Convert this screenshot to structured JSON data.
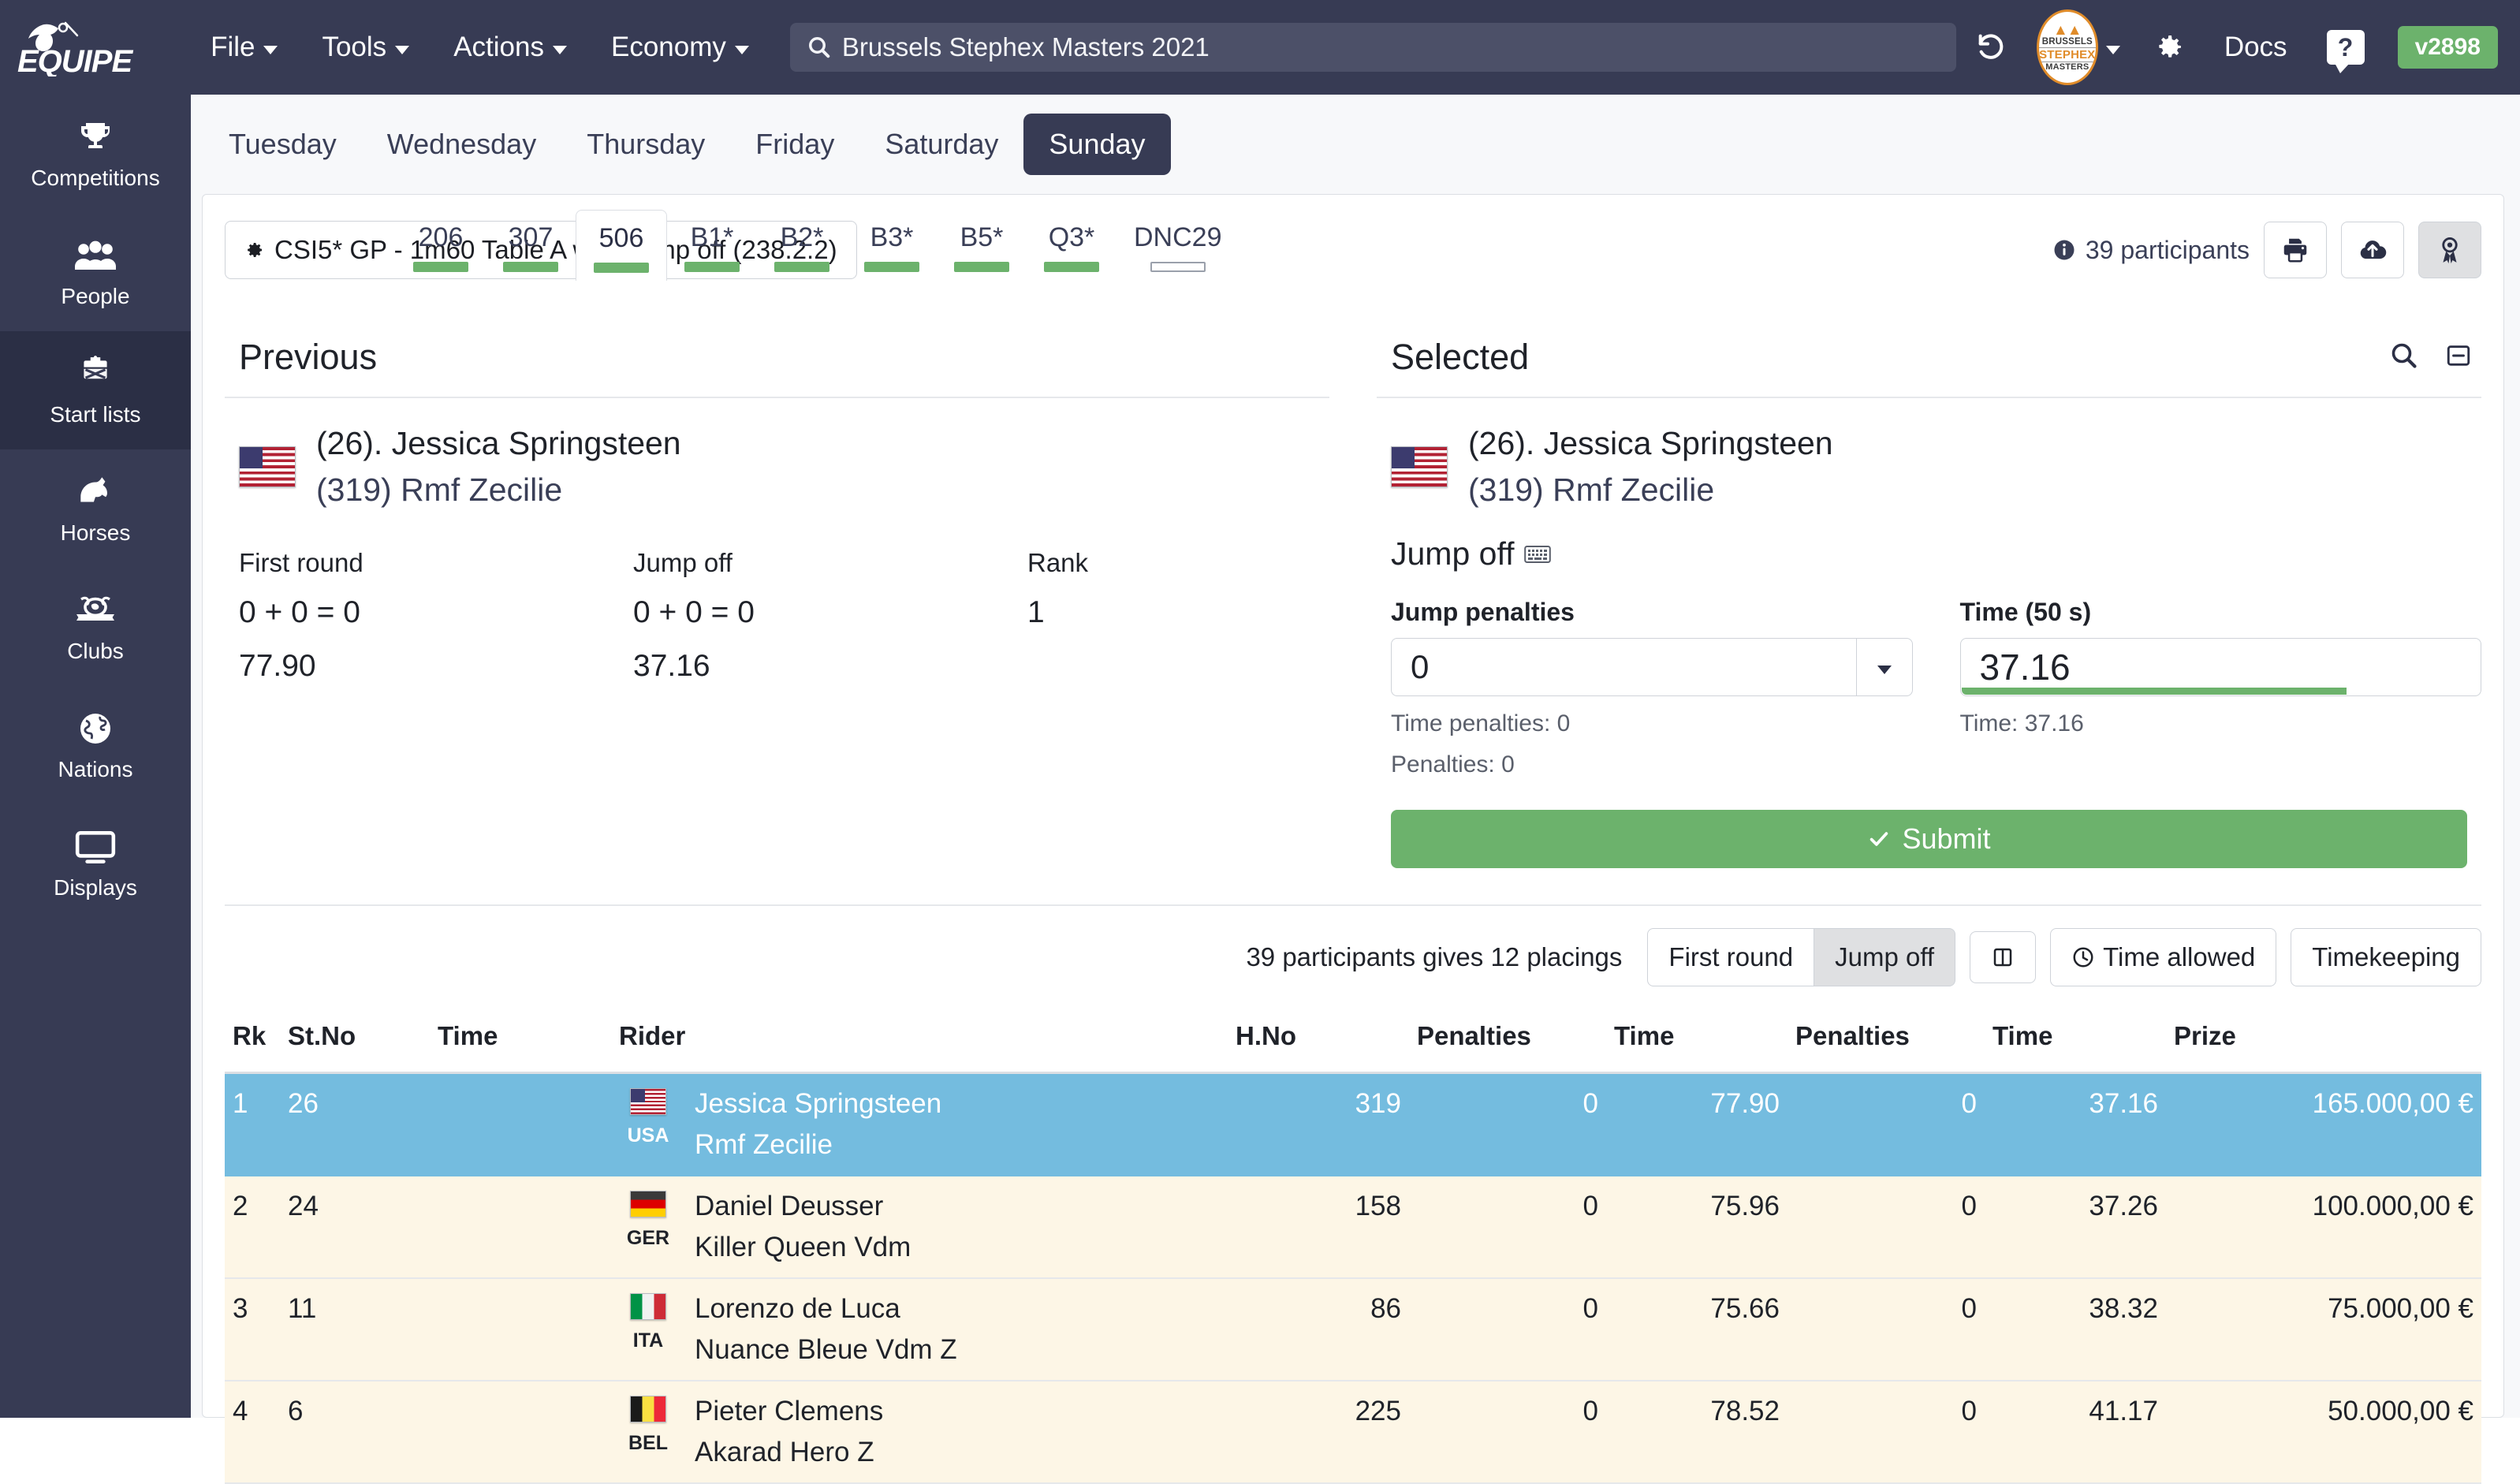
{
  "navbar": {
    "logo_text": "EQUIPE",
    "menu": [
      {
        "label": "File"
      },
      {
        "label": "Tools"
      },
      {
        "label": "Actions"
      },
      {
        "label": "Economy"
      }
    ],
    "search": {
      "value": "Brussels Stephex Masters 2021",
      "icon": "search-icon"
    },
    "history_icon": "history-undo-icon",
    "event_badge": {
      "line1": "BRUSSELS",
      "line2": "STEPHEX",
      "line3": "MASTERS"
    },
    "settings_icon": "gear-icon",
    "docs_label": "Docs",
    "help_label": "?",
    "version": "v2898"
  },
  "sidebar": {
    "items": [
      {
        "label": "Competitions",
        "icon": "trophy-icon",
        "active": false
      },
      {
        "label": "People",
        "icon": "people-icon",
        "active": false
      },
      {
        "label": "Start lists",
        "icon": "clipboard-icon",
        "active": true
      },
      {
        "label": "Horses",
        "icon": "horse-head-icon",
        "active": false
      },
      {
        "label": "Clubs",
        "icon": "club-crest-icon",
        "active": false
      },
      {
        "label": "Nations",
        "icon": "globe-icon",
        "active": false
      },
      {
        "label": "Displays",
        "icon": "monitor-icon",
        "active": false
      }
    ]
  },
  "days": [
    {
      "label": "Tuesday",
      "active": false
    },
    {
      "label": "Wednesday",
      "active": false
    },
    {
      "label": "Thursday",
      "active": false
    },
    {
      "label": "Friday",
      "active": false
    },
    {
      "label": "Saturday",
      "active": false
    },
    {
      "label": "Sunday",
      "active": true
    }
  ],
  "classes": [
    {
      "label": "206",
      "active": false,
      "status": "green"
    },
    {
      "label": "307",
      "active": false,
      "status": "green"
    },
    {
      "label": "506",
      "active": true,
      "status": "green"
    },
    {
      "label": "B1*",
      "active": false,
      "status": "green"
    },
    {
      "label": "B2*",
      "active": false,
      "status": "green"
    },
    {
      "label": "B3*",
      "active": false,
      "status": "green"
    },
    {
      "label": "B5*",
      "active": false,
      "status": "green"
    },
    {
      "label": "Q3*",
      "active": false,
      "status": "green"
    },
    {
      "label": "DNC29",
      "active": false,
      "status": "empty"
    }
  ],
  "class_header": {
    "gear_icon": "gear-icon",
    "title": "CSI5* GP - 1m60 Table A with Jump off (238.2.2)",
    "participants": "39 participants",
    "info_icon": "info-circle-icon",
    "buttons": [
      {
        "icon": "printer-icon",
        "name": "print-button",
        "pressed": false
      },
      {
        "icon": "cloud-upload-icon",
        "name": "upload-button",
        "pressed": false
      },
      {
        "icon": "rosette-award-icon",
        "name": "prizes-button",
        "pressed": true
      }
    ]
  },
  "previous": {
    "title": "Previous",
    "flag": "usa-flag",
    "rider": "(26). Jessica Springsteen",
    "horse": "(319) Rmf Zecilie",
    "stats": [
      {
        "label": "First round",
        "value1": "0 + 0 = 0",
        "value2": "77.90"
      },
      {
        "label": "Jump off",
        "value1": "0 + 0 = 0",
        "value2": "37.16"
      },
      {
        "label": "Rank",
        "value1": "1",
        "value2": ""
      }
    ]
  },
  "selected": {
    "title": "Selected",
    "search_icon": "search-icon",
    "collapse_icon": "collapse-minus-icon",
    "flag": "usa-flag",
    "rider": "(26). Jessica Springsteen",
    "horse": "(319) Rmf Zecilie",
    "round_label": "Jump off",
    "keyboard_icon": "keyboard-icon",
    "jump_penalties_label": "Jump penalties",
    "jump_penalties_value": "0",
    "time_label": "Time (50 s)",
    "time_value": "37.16",
    "time_progress_pct": 74,
    "time_penalties_note": "Time penalties: 0",
    "penalties_note": "Penalties: 0",
    "time_note": "Time: 37.16",
    "submit_label": "Submit",
    "submit_icon": "check-icon",
    "submit_color": "#6cb26c"
  },
  "toolbar": {
    "hint": "39 participants gives 12 placings",
    "buttons": [
      {
        "label": "First round",
        "active": false,
        "icon": ""
      },
      {
        "label": "Jump off",
        "active": true,
        "icon": ""
      },
      {
        "label": "",
        "active": false,
        "icon": "columns-layout-icon"
      },
      {
        "label": "Time allowed",
        "active": false,
        "icon": "clock-icon"
      },
      {
        "label": "Timekeeping",
        "active": false,
        "icon": ""
      }
    ]
  },
  "results": {
    "columns": [
      "Rk",
      "St.No",
      "Time",
      "Rider",
      "H.No",
      "Penalties",
      "Time",
      "Penalties",
      "Time",
      "Prize"
    ],
    "rows": [
      {
        "rk": "1",
        "stno": "26",
        "time_col": "",
        "flag": "usa-flag",
        "iso": "USA",
        "rider": "Jessica Springsteen",
        "horse": "Rmf Zecilie",
        "hno": "319",
        "pen1": "0",
        "time1": "77.90",
        "pen2": "0",
        "time2": "37.16",
        "prize": "165.000,00 €",
        "selected": true
      },
      {
        "rk": "2",
        "stno": "24",
        "time_col": "",
        "flag": "ger-flag",
        "iso": "GER",
        "rider": "Daniel Deusser",
        "horse": "Killer Queen Vdm",
        "hno": "158",
        "pen1": "0",
        "time1": "75.96",
        "pen2": "0",
        "time2": "37.26",
        "prize": "100.000,00 €",
        "selected": false
      },
      {
        "rk": "3",
        "stno": "11",
        "time_col": "",
        "flag": "ita-flag",
        "iso": "ITA",
        "rider": "Lorenzo de Luca",
        "horse": "Nuance Bleue Vdm Z",
        "hno": "86",
        "pen1": "0",
        "time1": "75.66",
        "pen2": "0",
        "time2": "38.32",
        "prize": "75.000,00 €",
        "selected": false
      },
      {
        "rk": "4",
        "stno": "6",
        "time_col": "",
        "flag": "bel-flag",
        "iso": "BEL",
        "rider": "Pieter Clemens",
        "horse": "Akarad Hero Z",
        "hno": "225",
        "pen1": "0",
        "time1": "78.52",
        "pen2": "0",
        "time2": "41.17",
        "prize": "50.000,00 €",
        "selected": false
      }
    ]
  }
}
